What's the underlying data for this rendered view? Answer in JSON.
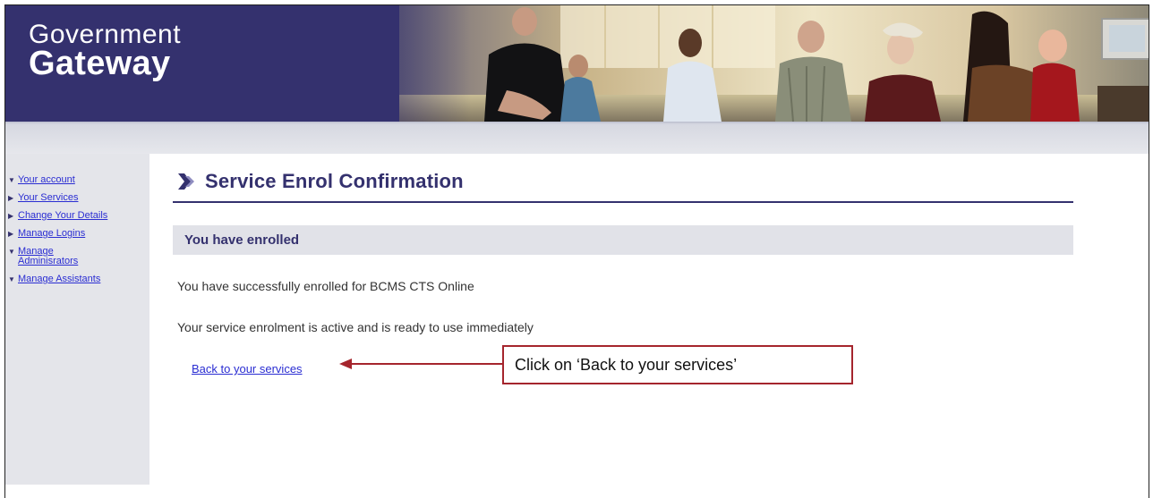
{
  "header": {
    "logo_line1": "Government",
    "logo_line2": "Gateway"
  },
  "sidebar": {
    "items": [
      {
        "label": "Your account",
        "arrow": "down"
      },
      {
        "label": "Your Services",
        "arrow": "right"
      },
      {
        "label": "Change Your Details",
        "arrow": "right"
      },
      {
        "label": "Manage Logins",
        "arrow": "right"
      },
      {
        "label": "Manage Administrators",
        "label_lines": [
          "Manage",
          "Adminisrators"
        ],
        "arrow": "down"
      },
      {
        "label": "Manage Assistants",
        "arrow": "down"
      }
    ]
  },
  "main": {
    "title": "Service Enrol Confirmation",
    "subheading": "You have enrolled",
    "message1": "You have successfully enrolled for BCMS CTS Online",
    "message2": "Your service enrolment is active and is ready to use immediately",
    "back_link": "Back to your services"
  },
  "annotation": {
    "callout_text": "Click on ‘Back to your services’"
  },
  "colors": {
    "brand": "#34316e",
    "link": "#2a2dd2",
    "callout_border": "#a5252d"
  }
}
